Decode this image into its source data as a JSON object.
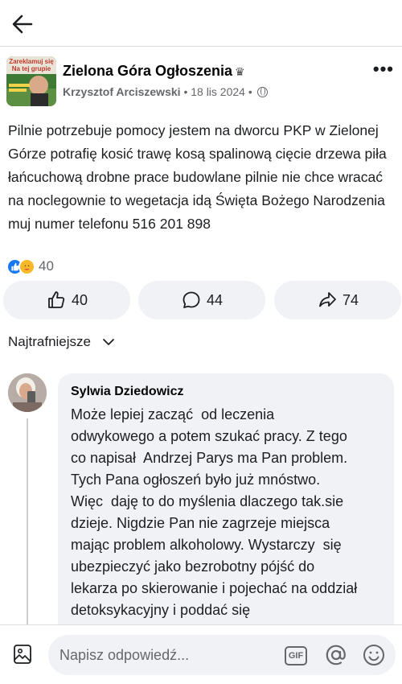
{
  "post": {
    "group_name": "Zielona Góra Ogłoszenia",
    "author": "Krzysztof Arciszewski",
    "date": "18 lis 2024",
    "separator": "•",
    "avatar_text_line1": "Zareklamuj się",
    "avatar_text_line2": "Na tej grupie",
    "body": "Pilnie potrzebuje pomocy jestem na dworcu PKP w Zielonej Górze potrafię kosić trawę kosą spalinową cięcie drzewa piła łańcuchową drobne prace budowlane pilnie nie chce wracać na noclegownie to wegetacja idą Święta Bożego Narodzenia muj numer telefonu 516 201 898",
    "reaction_count": "40"
  },
  "actions": {
    "like_count": "40",
    "comment_count": "44",
    "share_count": "74"
  },
  "sort": {
    "label": "Najtrafniejsze"
  },
  "comment": {
    "author": "Sylwia Dziedowicz",
    "text": "Może lepiej zacząć  od leczenia odwykowego a potem szukać pracy. Z tego co napisał  Andrzej Parys ma Pan problem. Tych Pana ogłoszeń było już mnóstwo.  Więc  daję to do myślenia dlaczego tak.sie dzieje. Nigdzie Pan nie zagrzeje miejsca mając problem alkoholowy. Wystarczy  się ubezpieczyć jako bezrobotny pójść do lekarza po skierowanie i pojechać na oddział detoksykacyjny i poddać się"
  },
  "composer": {
    "placeholder": "Napisz odpowiedź...",
    "gif_label": "GIF"
  },
  "colors": {
    "accent": "#1877f2",
    "pill_bg": "#f0f2f5",
    "muted_text": "#65676b"
  },
  "icons": [
    "back-arrow-icon",
    "crown-icon",
    "globe-icon",
    "more-icon",
    "like-icon",
    "comment-icon",
    "share-icon",
    "chevron-down-icon",
    "image-icon",
    "gif-icon",
    "mention-icon",
    "emoji-icon"
  ]
}
